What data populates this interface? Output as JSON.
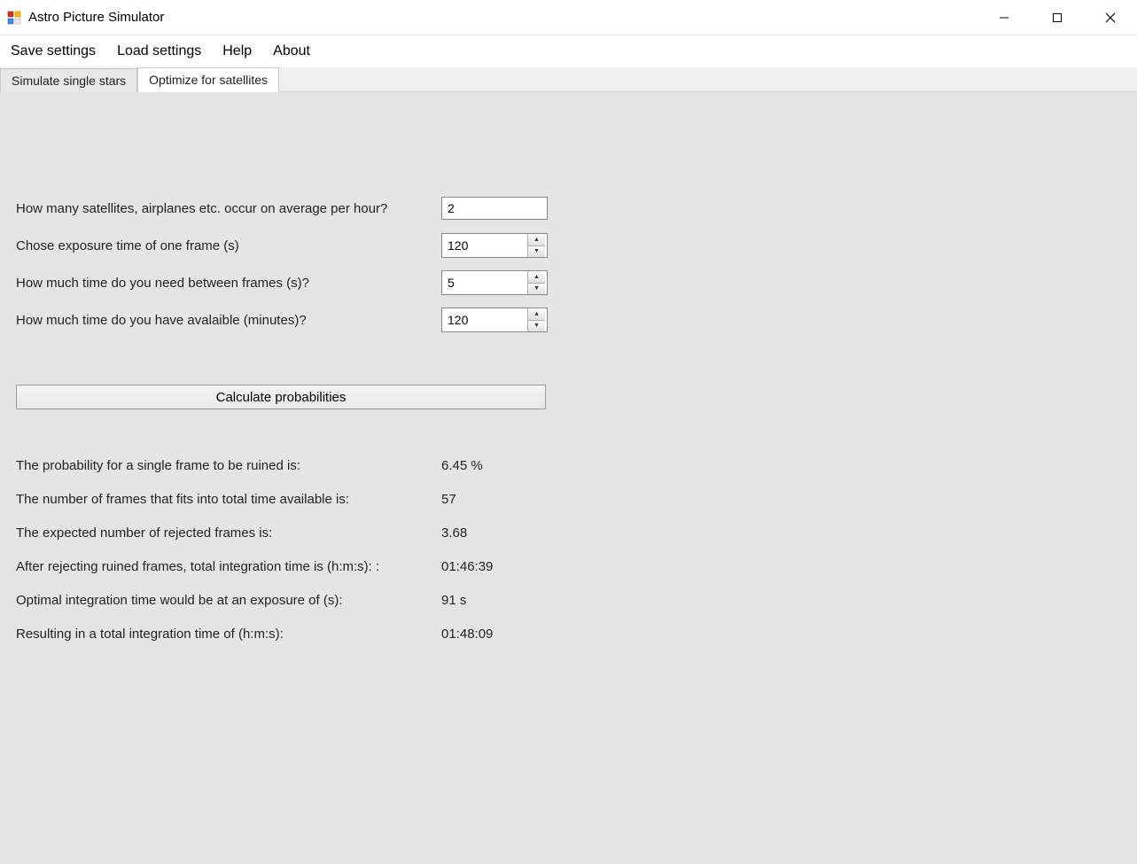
{
  "window": {
    "title": "Astro Picture Simulator"
  },
  "menu": {
    "save": "Save settings",
    "load": "Load settings",
    "help": "Help",
    "about": "About"
  },
  "tabs": {
    "single_stars": "Simulate single stars",
    "satellites": "Optimize for satellites"
  },
  "form": {
    "occur_label": "How many satellites, airplanes  etc. occur on average per hour?",
    "occur_value": "2",
    "exposure_label": "Chose exposure time of one frame (s)",
    "exposure_value": "120",
    "between_label": "How much time do you need between frames (s)?",
    "between_value": "5",
    "available_label": "How much time do you have avalaible (minutes)?",
    "available_value": "120",
    "calculate_button": "Calculate probabilities"
  },
  "results": {
    "prob_label": "The probability for a single frame to be ruined is:",
    "prob_value": "6.45 %",
    "frames_label": "The number of frames that fits into total time available is:",
    "frames_value": "57",
    "rejected_label": "The expected number of rejected frames is:",
    "rejected_value": "3.68",
    "integration_label": "After rejecting ruined frames, total integration time is (h:m:s): :",
    "integration_value": "01:46:39",
    "optimal_label": "Optimal integration time would be at an exposure of (s):",
    "optimal_value": "91 s",
    "total_label": "Resulting in a total integration time of (h:m:s):",
    "total_value": "01:48:09"
  }
}
